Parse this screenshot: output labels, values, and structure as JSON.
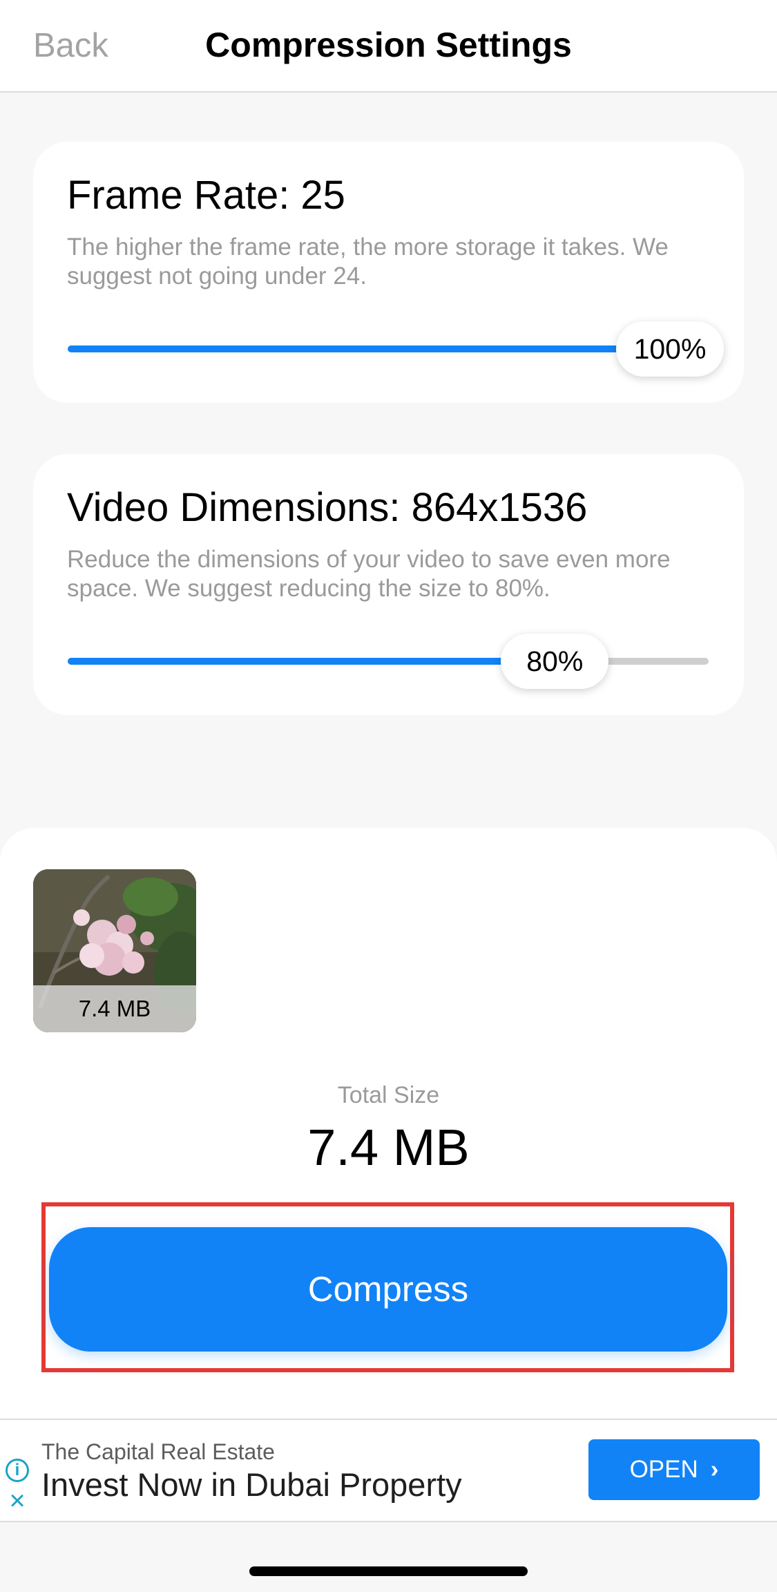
{
  "nav": {
    "back_label": "Back",
    "title": "Compression Settings"
  },
  "frame_rate": {
    "title": "Frame Rate: 25",
    "description": "The higher the frame rate, the more storage it takes. We suggest not going under 24.",
    "slider_label": "100%",
    "slider_value": 1.0
  },
  "dimensions": {
    "title": "Video Dimensions: 864x1536",
    "description": "Reduce the dimensions of your video to save even more space. We suggest reducing the size to 80%.",
    "slider_label": "80%",
    "slider_value": 0.76
  },
  "video": {
    "size_label": "7.4 MB"
  },
  "total": {
    "label": "Total Size",
    "value": "7.4 MB"
  },
  "compress_button": {
    "label": "Compress"
  },
  "ad": {
    "advertiser": "The Capital Real Estate",
    "headline": "Invest Now in Dubai Property",
    "cta_label": "OPEN",
    "cta_chevron": "›"
  },
  "colors": {
    "accent": "#1183f7",
    "highlight_border": "#e53935"
  }
}
